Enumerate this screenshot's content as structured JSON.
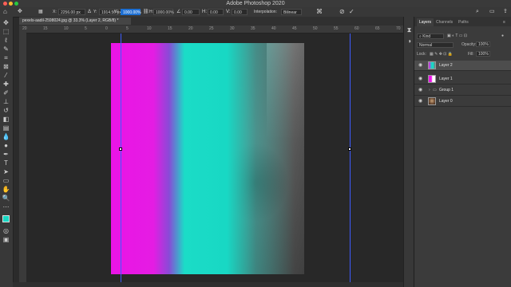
{
  "window": {
    "title": "Adobe Photoshop 2020"
  },
  "options_bar": {
    "x_value": "2256.00 px",
    "y_value": "1914.50 px",
    "w_value": "1000.00%",
    "h_value": "1000.00%",
    "angle_value": "0.00",
    "h_skew_value": "0.00",
    "v_skew_value": "0.00",
    "interpolation_label": "Interpolation:",
    "interpolation_value": "Bilinear",
    "x_label": "X:",
    "y_label": "Y:",
    "w_label": "W:",
    "h_label": "H:"
  },
  "document": {
    "tab_title": "pexels-aadil-2598024.jpg @ 33.3% (Layer 2, RGB/8) *"
  },
  "ruler": {
    "marks": [
      "20",
      "15",
      "10",
      "5",
      "0",
      "5",
      "10",
      "15",
      "20",
      "25",
      "30",
      "35",
      "40",
      "45",
      "50",
      "55",
      "60",
      "65",
      "70"
    ]
  },
  "panels": {
    "tabs": [
      "Layers",
      "Channels",
      "Paths"
    ],
    "active_tab": "Layers",
    "kind_placeholder": "Kind",
    "blend_mode": "Normal",
    "opacity_label": "Opacity:",
    "opacity_value": "100%",
    "lock_label": "Lock:",
    "fill_label": "Fill:",
    "fill_value": "100%"
  },
  "layers": [
    {
      "name": "Layer 2",
      "selected": true
    },
    {
      "name": "Layer 1",
      "selected": false
    },
    {
      "name": "Group 1",
      "selected": false
    },
    {
      "name": "Layer 0",
      "selected": false
    }
  ],
  "colors": {
    "magenta": "#ea14e6",
    "cyan": "#18d8c4",
    "guide": "#3d5bff",
    "selection": "#1d6fd3"
  }
}
